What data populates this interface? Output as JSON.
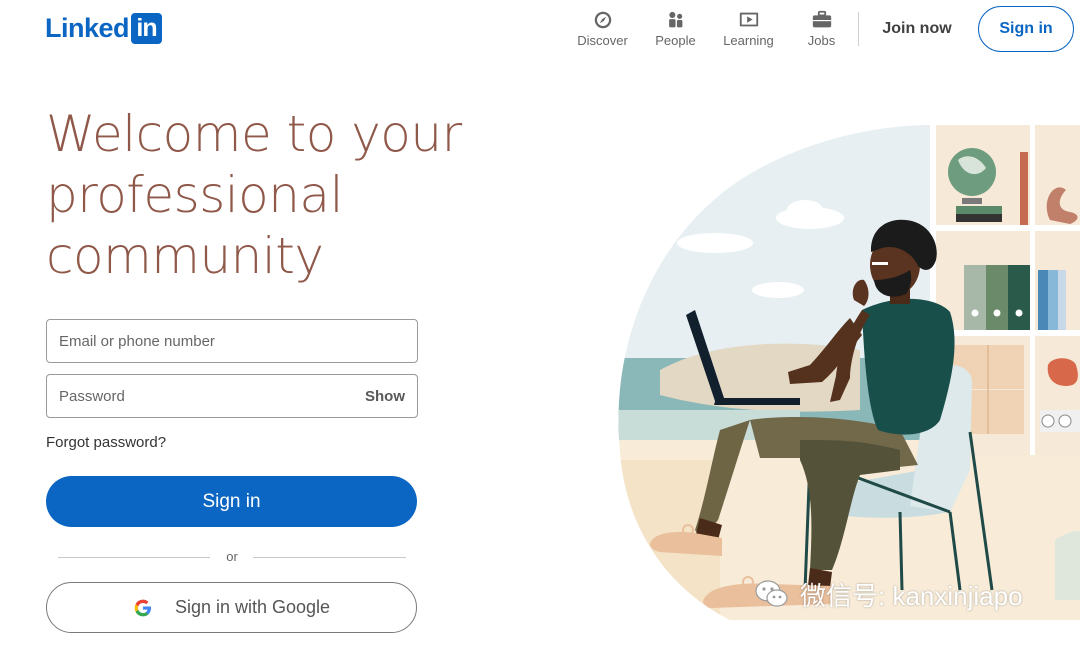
{
  "header": {
    "logo_text": "Linked",
    "logo_box_text": "in",
    "nav": [
      {
        "label": "Discover",
        "icon": "compass-icon"
      },
      {
        "label": "People",
        "icon": "people-icon"
      },
      {
        "label": "Learning",
        "icon": "video-play-icon"
      },
      {
        "label": "Jobs",
        "icon": "briefcase-icon"
      }
    ],
    "join_now": "Join now",
    "sign_in": "Sign in"
  },
  "hero": {
    "headline_line1": "Welcome to your",
    "headline_line2": "professional",
    "headline_line3": "community"
  },
  "form": {
    "email_placeholder": "Email or phone number",
    "password_placeholder": "Password",
    "show_label": "Show",
    "forgot_password": "Forgot password?",
    "sign_in_button": "Sign in",
    "or_text": "or",
    "google_button": "Sign in with Google"
  },
  "watermark": {
    "text": "微信号: kanxinjiapo"
  },
  "colors": {
    "brand_blue": "#0a66c2",
    "headline": "#8f5849",
    "nav_gray": "#666666"
  }
}
